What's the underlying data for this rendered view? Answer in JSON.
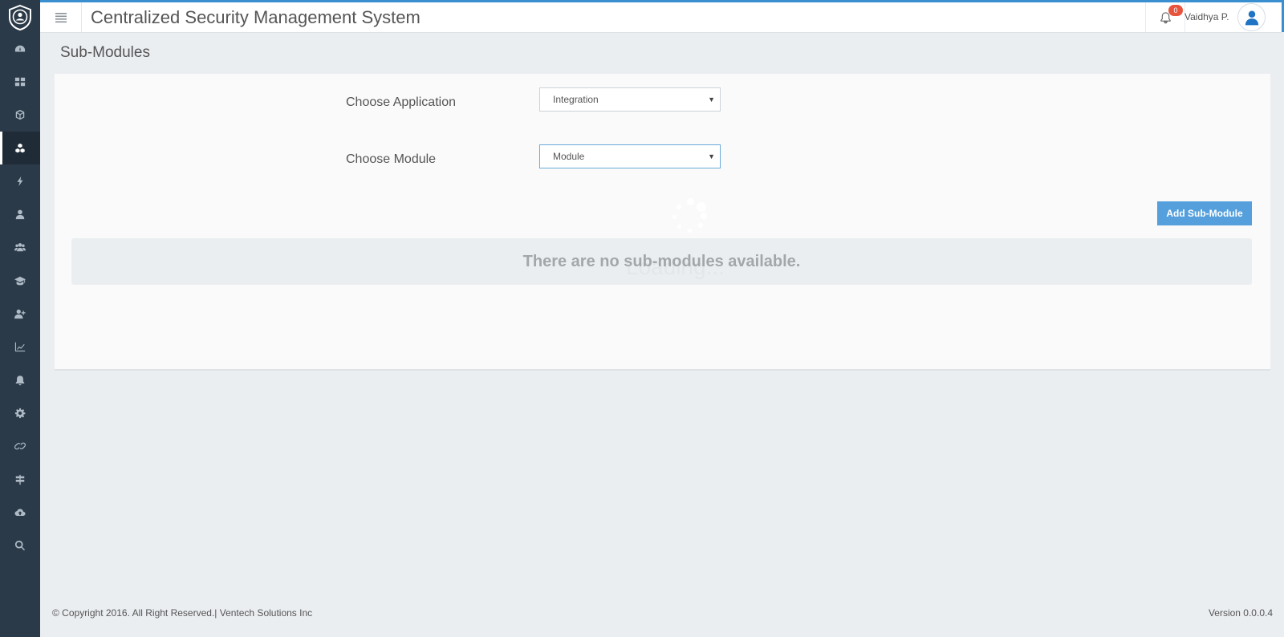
{
  "header": {
    "app_title": "Centralized Security Management System",
    "notification_count": "0",
    "user_name": "Vaidhya P."
  },
  "sidebar": {
    "items": [
      {
        "icon": "dashboard-icon"
      },
      {
        "icon": "grid-icon"
      },
      {
        "icon": "cube-icon"
      },
      {
        "icon": "cubes-icon",
        "active": true
      },
      {
        "icon": "bolt-icon"
      },
      {
        "icon": "user-icon"
      },
      {
        "icon": "users-icon"
      },
      {
        "icon": "graduation-cap-icon"
      },
      {
        "icon": "user-plus-icon"
      },
      {
        "icon": "line-chart-icon"
      },
      {
        "icon": "bell-icon"
      },
      {
        "icon": "gear-icon"
      },
      {
        "icon": "link-icon"
      },
      {
        "icon": "signpost-icon"
      },
      {
        "icon": "cloud-upload-icon"
      },
      {
        "icon": "search-icon"
      }
    ]
  },
  "page": {
    "title": "Sub-Modules",
    "choose_application_label": "Choose Application",
    "application_value": "Integration",
    "choose_module_label": "Choose Module",
    "module_value": "Module",
    "add_button_label": "Add Sub-Module",
    "empty_message": "There are no sub-modules available.",
    "loading_text": "Loading..."
  },
  "footer": {
    "copyright": "© Copyright 2016. All Right Reserved.| Ventech Solutions Inc",
    "version": "Version 0.0.0.4"
  },
  "colors": {
    "sidebar_bg": "#2b3a48",
    "accent": "#3a8fd0",
    "button": "#55a0dc",
    "badge": "#e8553f"
  }
}
